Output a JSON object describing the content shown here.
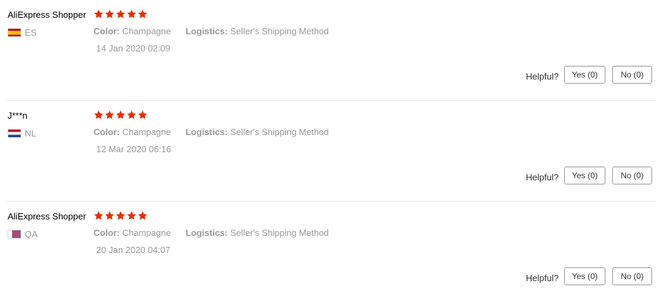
{
  "helpful_label": "Helpful?",
  "star_color": "#e62e04",
  "reviews": [
    {
      "reviewer": "AliExpress Shopper",
      "country_code": "ES",
      "flag": "flag-es",
      "rating": 5,
      "color_label": "Color:",
      "color_value": "Champagne",
      "logistics_label": "Logistics:",
      "logistics_value": "Seller's Shipping Method",
      "date": "14 Jan 2020 02:09",
      "yes_label": "Yes (0)",
      "no_label": "No (0)"
    },
    {
      "reviewer": "J***n",
      "country_code": "NL",
      "flag": "flag-nl",
      "rating": 5,
      "color_label": "Color:",
      "color_value": "Champagne",
      "logistics_label": "Logistics:",
      "logistics_value": "Seller's Shipping Method",
      "date": "12 Mar 2020 06:16",
      "yes_label": "Yes (0)",
      "no_label": "No (0)"
    },
    {
      "reviewer": "AliExpress Shopper",
      "country_code": "QA",
      "flag": "flag-qa",
      "rating": 5,
      "color_label": "Color:",
      "color_value": "Champagne",
      "logistics_label": "Logistics:",
      "logistics_value": "Seller's Shipping Method",
      "date": "20 Jan 2020 04:07",
      "yes_label": "Yes (0)",
      "no_label": "No (0)"
    }
  ]
}
